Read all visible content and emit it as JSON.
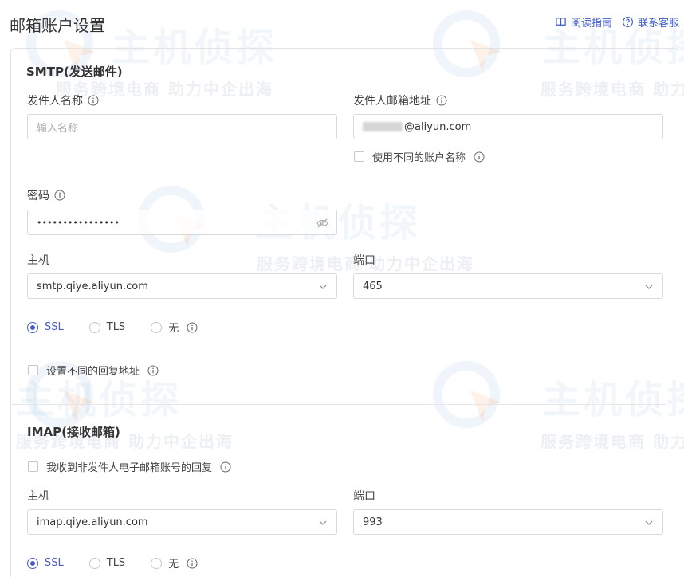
{
  "header": {
    "title": "邮箱账户设置",
    "links": [
      {
        "label": "阅读指南",
        "icon": "book-icon"
      },
      {
        "label": "联系客服",
        "icon": "help-circle-icon"
      }
    ]
  },
  "watermark": {
    "brand": "主机侦探",
    "slogan": "服务跨境电商 助力中企出海"
  },
  "smtp": {
    "title": "SMTP(发送邮件)",
    "sender_name": {
      "label": "发件人名称",
      "value": "",
      "placeholder": "输入名称"
    },
    "sender_email": {
      "label": "发件人邮箱地址",
      "value": "@aliyun.com"
    },
    "different_account": {
      "label": "使用不同的账户名称",
      "checked": false
    },
    "password": {
      "label": "密码",
      "value": "••••••••••••••••"
    },
    "host": {
      "label": "主机",
      "value": "smtp.qiye.aliyun.com"
    },
    "port": {
      "label": "端口",
      "value": "465"
    },
    "security": {
      "options": [
        "SSL",
        "TLS",
        "无"
      ],
      "selected": "SSL"
    },
    "reply_address": {
      "label": "设置不同的回复地址",
      "checked": false
    }
  },
  "imap": {
    "title": "IMAP(接收邮箱)",
    "non_sender_reply": {
      "label": "我收到非发件人电子邮箱账号的回复",
      "checked": false
    },
    "host": {
      "label": "主机",
      "value": "imap.qiye.aliyun.com"
    },
    "port": {
      "label": "端口",
      "value": "993"
    },
    "security": {
      "options": [
        "SSL",
        "TLS",
        "无"
      ],
      "selected": "SSL"
    }
  },
  "colors": {
    "accent": "#4b5cc4",
    "link": "#3e5ac7",
    "border": "#d9d9d9"
  }
}
